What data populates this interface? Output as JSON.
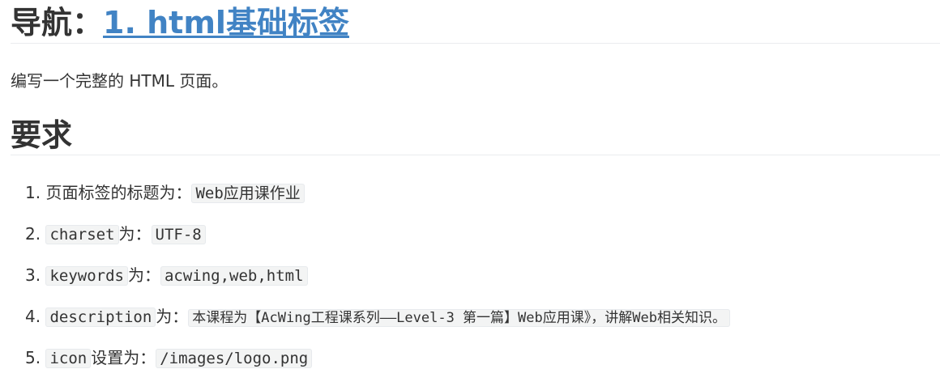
{
  "nav": {
    "prefix": "导航：",
    "link_text": "1. html基础标签"
  },
  "intro": "编写一个完整的 HTML 页面。",
  "section_title": "要求",
  "requirements": [
    {
      "number": "1.",
      "pre": "",
      "code1": "",
      "mid": "页面标签的标题为：",
      "code2": "Web应用课作业"
    },
    {
      "number": "2.",
      "pre": "",
      "code1": "charset",
      "mid": "为：",
      "code2": "UTF-8"
    },
    {
      "number": "3.",
      "pre": "",
      "code1": "keywords",
      "mid": "为：",
      "code2": "acwing,web,html"
    },
    {
      "number": "4.",
      "pre": "",
      "code1": "description",
      "mid": "为：",
      "code2": "本课程为【AcWing工程课系列——Level-3 第一篇】Web应用课》，讲解Web相关知识。"
    },
    {
      "number": "5.",
      "pre": "",
      "code1": "icon",
      "mid": "设置为：",
      "code2": "/images/logo.png"
    }
  ],
  "colors": {
    "link": "#4183c4",
    "text": "#333333",
    "code_bg": "#f3f4f4"
  }
}
